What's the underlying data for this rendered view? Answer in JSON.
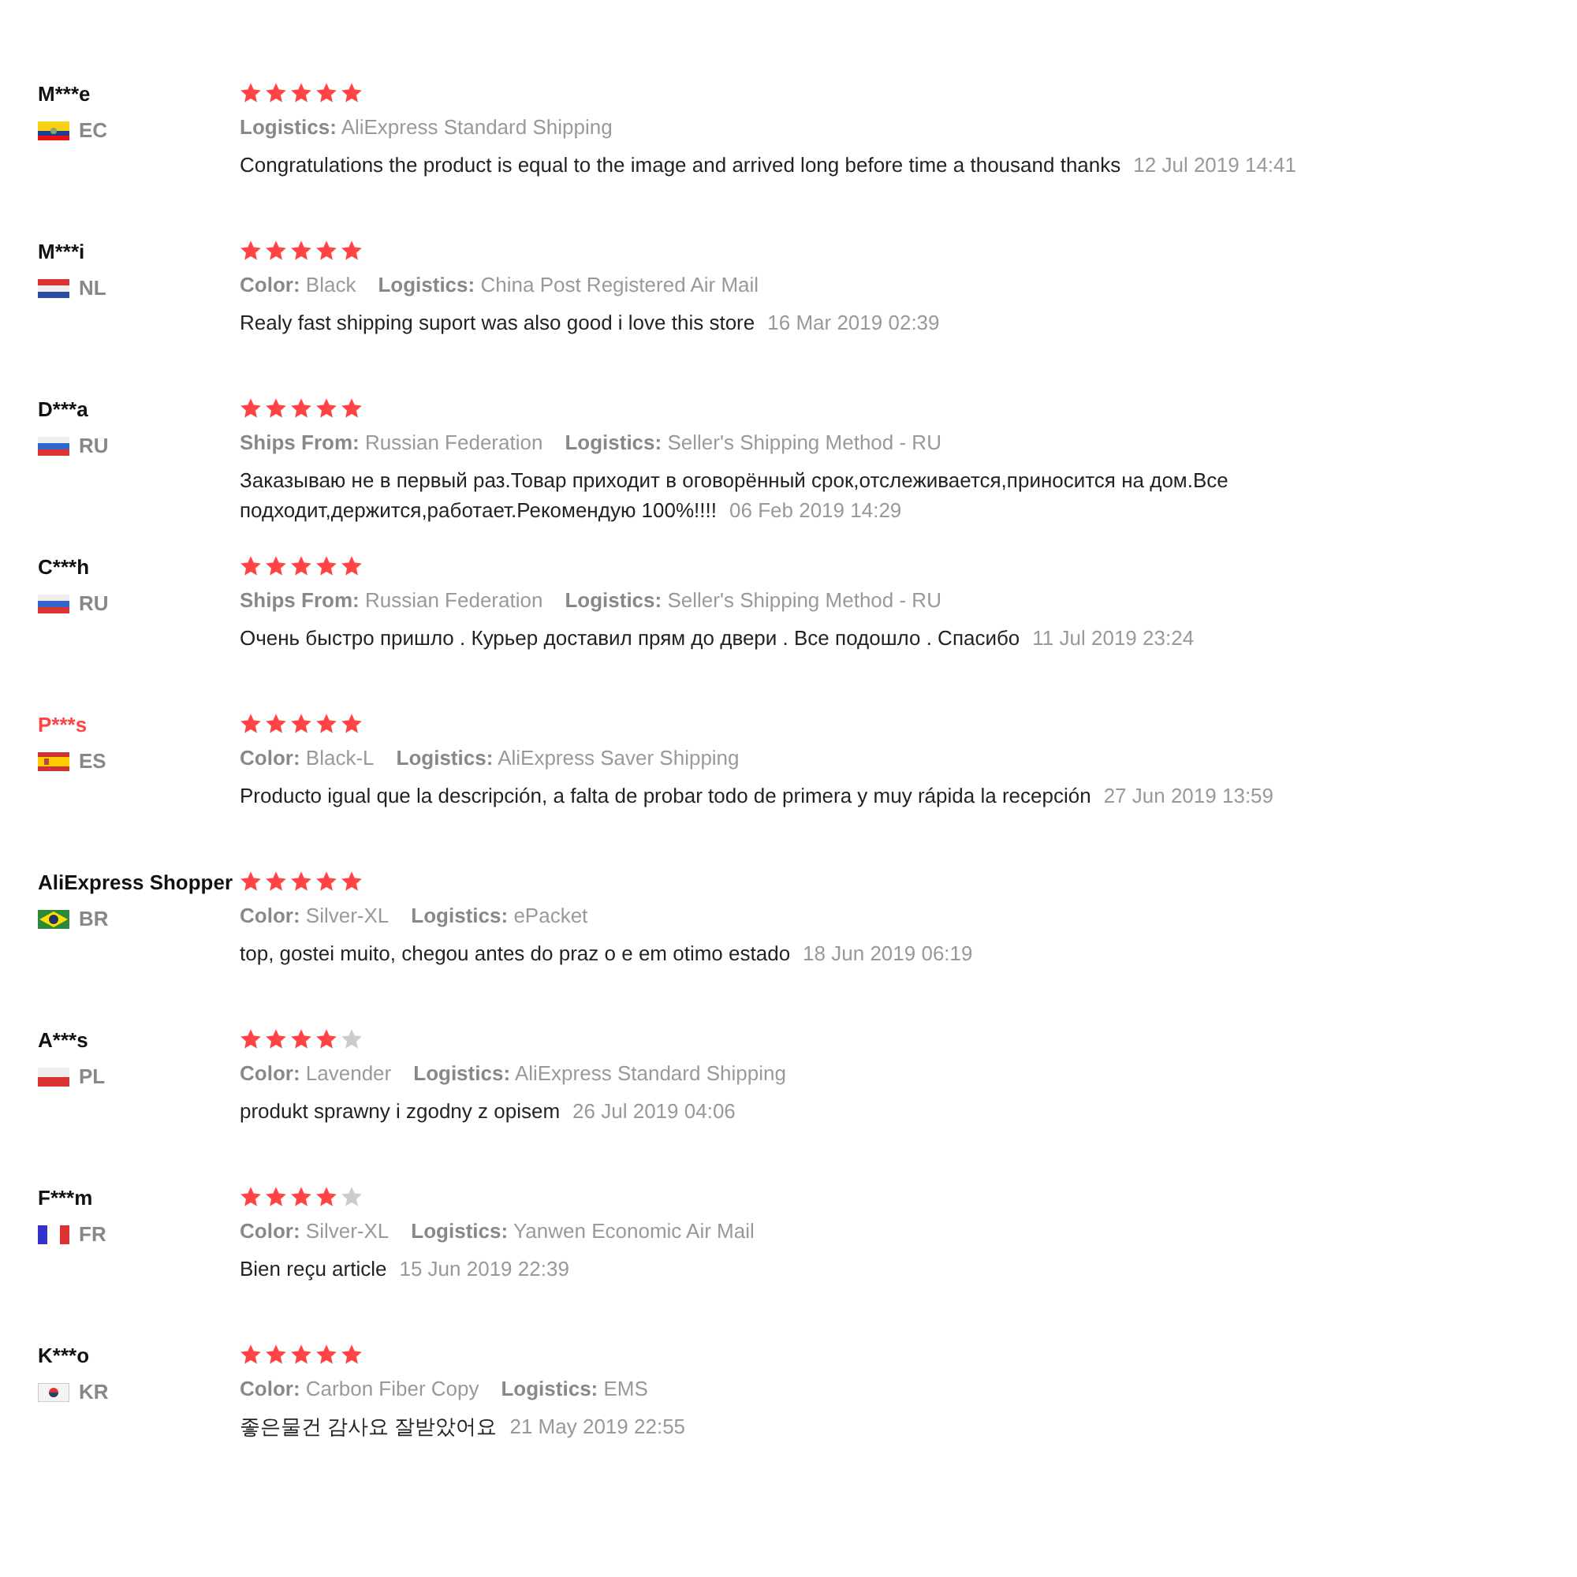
{
  "reviews": [
    {
      "name": "M***e",
      "highlighted": false,
      "kind": "ecuador",
      "country": "EC",
      "stars": 5,
      "attributes": [
        {
          "label": "Logistics:",
          "value": "AliExpress Standard Shipping"
        }
      ],
      "text": "Congratulations the product is equal to the image and arrived long before time a thousand thanks",
      "date": "12 Jul 2019 14:41"
    },
    {
      "name": "M***i",
      "highlighted": false,
      "kind": "netherlands",
      "country": "NL",
      "stars": 5,
      "attributes": [
        {
          "label": "Color:",
          "value": "Black"
        },
        {
          "label": "Logistics:",
          "value": "China Post Registered Air Mail"
        }
      ],
      "text": "Realy fast shipping suport was also good i love this store",
      "date": "16 Mar 2019 02:39"
    },
    {
      "name": "D***a",
      "highlighted": false,
      "kind": "russia",
      "country": "RU",
      "stars": 5,
      "attributes": [
        {
          "label": "Ships From:",
          "value": "Russian Federation"
        },
        {
          "label": "Logistics:",
          "value": "Seller's Shipping Method - RU"
        }
      ],
      "text": "Заказываю не в первый раз.Товар приходит в оговорённый срок,отслеживается,приносится на дом.Все подходит,держится,работает.Рекомендую 100%!!!!",
      "date": "06 Feb 2019 14:29"
    },
    {
      "name": "C***h",
      "highlighted": false,
      "kind": "russia",
      "country": "RU",
      "stars": 5,
      "attributes": [
        {
          "label": "Ships From:",
          "value": "Russian Federation"
        },
        {
          "label": "Logistics:",
          "value": "Seller's Shipping Method - RU"
        }
      ],
      "text": "Очень быстро пришло . Курьер доставил прям до двери . Все подошло . Спасибо",
      "date": "11 Jul 2019 23:24"
    },
    {
      "name": "P***s",
      "highlighted": true,
      "kind": "spain",
      "country": "ES",
      "stars": 5,
      "attributes": [
        {
          "label": "Color:",
          "value": "Black-L"
        },
        {
          "label": "Logistics:",
          "value": "AliExpress Saver Shipping"
        }
      ],
      "text": "Producto igual que la descripción, a falta de probar todo de primera y muy rápida la recepción",
      "date": "27 Jun 2019 13:59"
    },
    {
      "name": "AliExpress Shopper",
      "highlighted": false,
      "kind": "brazil",
      "country": "BR",
      "stars": 5,
      "attributes": [
        {
          "label": "Color:",
          "value": "Silver-XL"
        },
        {
          "label": "Logistics:",
          "value": "ePacket"
        }
      ],
      "text": "top, gostei muito, chegou antes do praz o e em otimo estado",
      "date": "18 Jun 2019 06:19"
    },
    {
      "name": "A***s",
      "highlighted": false,
      "kind": "poland",
      "country": "PL",
      "stars": 4,
      "attributes": [
        {
          "label": "Color:",
          "value": "Lavender"
        },
        {
          "label": "Logistics:",
          "value": "AliExpress Standard Shipping"
        }
      ],
      "text": "produkt sprawny i zgodny z opisem",
      "date": "26 Jul 2019 04:06"
    },
    {
      "name": "F***m",
      "highlighted": false,
      "kind": "france",
      "country": "FR",
      "stars": 4,
      "attributes": [
        {
          "label": "Color:",
          "value": "Silver-XL"
        },
        {
          "label": "Logistics:",
          "value": "Yanwen Economic Air Mail"
        }
      ],
      "text": "Bien reçu article",
      "date": "15 Jun 2019 22:39"
    },
    {
      "name": "K***o",
      "highlighted": false,
      "kind": "korea",
      "country": "KR",
      "stars": 5,
      "attributes": [
        {
          "label": "Color:",
          "value": "Carbon Fiber Copy"
        },
        {
          "label": "Logistics:",
          "value": "EMS"
        }
      ],
      "text": "좋은물건 감사요 잘받았어요",
      "date": "21 May 2019 22:55"
    }
  ]
}
